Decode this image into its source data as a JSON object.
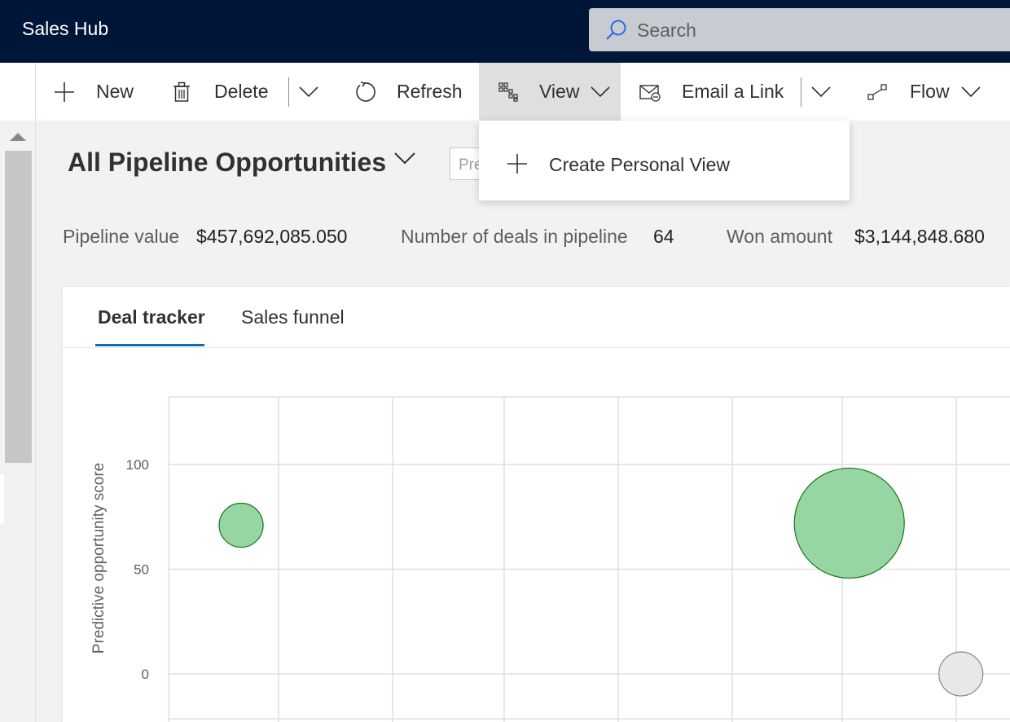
{
  "app": {
    "title": "Sales Hub"
  },
  "search": {
    "placeholder": "Search"
  },
  "commandbar": {
    "new": "New",
    "delete": "Delete",
    "refresh": "Refresh",
    "view": "View",
    "email_link": "Email a Link",
    "flow": "Flow"
  },
  "view_menu": {
    "items": [
      {
        "label": "Create Personal View",
        "icon": "plus-icon"
      }
    ]
  },
  "page": {
    "title": "All Pipeline Opportunities",
    "filter_placeholder": "Pre"
  },
  "kpis": [
    {
      "label": "Pipeline value",
      "value": "$457,692,085.050"
    },
    {
      "label": "Number of deals in pipeline",
      "value": "64"
    },
    {
      "label": "Won amount",
      "value": "$3,144,848.680"
    }
  ],
  "tabs": [
    {
      "label": "Deal tracker",
      "active": true
    },
    {
      "label": "Sales funnel",
      "active": false
    }
  ],
  "chart_data": {
    "type": "scatter",
    "ylabel": "Predictive opportunity score",
    "yticks": [
      100,
      50,
      0
    ],
    "ylim": [
      -21,
      133
    ],
    "grid": true,
    "points": [
      {
        "x": 0.65,
        "y": 71,
        "size": 1,
        "color": "#92d3a0"
      },
      {
        "x": 6.1,
        "y": 72,
        "size": 2.5,
        "color": "#92d3a0"
      },
      {
        "x": 7.1,
        "y": 0,
        "size": 1,
        "color": "#e8e8e8"
      }
    ]
  },
  "colors": {
    "topbar": "#001639",
    "accent": "#0f6cbd",
    "bubble_fill": "#92d3a0",
    "bubble_stroke": "#107c10"
  }
}
